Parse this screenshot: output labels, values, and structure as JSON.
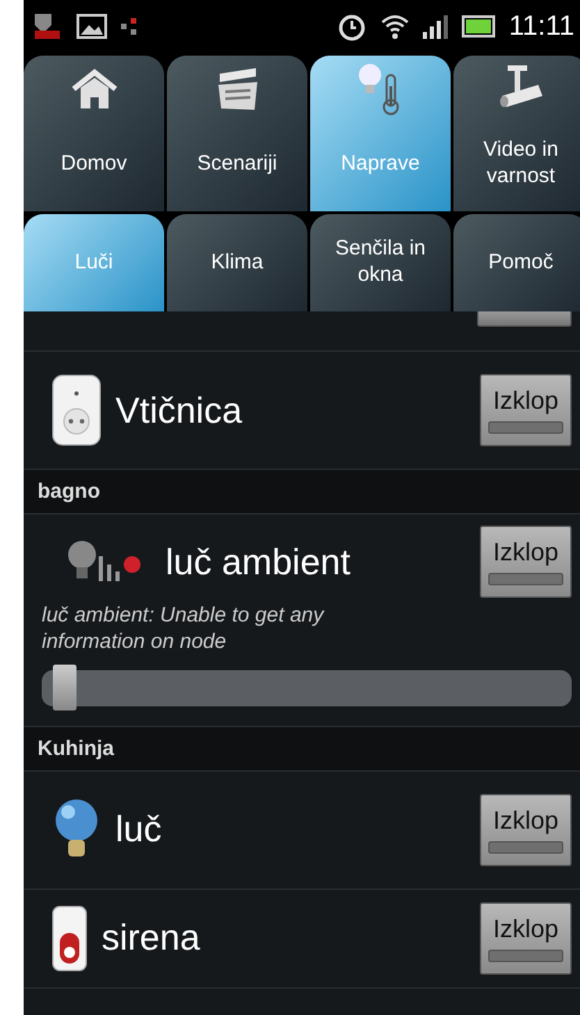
{
  "status_bar": {
    "time": "11:11"
  },
  "main_tabs": [
    {
      "label": "Domov",
      "kind": "home",
      "selected": false
    },
    {
      "label": "Scenariji",
      "kind": "scenes",
      "selected": false
    },
    {
      "label": "Naprave",
      "kind": "devices",
      "selected": true
    },
    {
      "label": "Video in varnost",
      "kind": "video",
      "selected": false
    }
  ],
  "sub_tabs": [
    {
      "label": "Luči",
      "selected": true
    },
    {
      "label": "Klima",
      "selected": false
    },
    {
      "label": "Senčila in okna",
      "selected": false
    },
    {
      "label": "Pomoč",
      "selected": false
    }
  ],
  "list": [
    {
      "kind": "socket",
      "name": "Vtičnica",
      "button": "Izklop",
      "on": false
    },
    {
      "kind": "header",
      "name": "bagno"
    },
    {
      "kind": "dimmer",
      "name": "luč ambient",
      "button": "Izklop",
      "on": false,
      "message": "luč ambient: Unable to get any information on node",
      "level": 0.02
    },
    {
      "kind": "header",
      "name": "Kuhinja"
    },
    {
      "kind": "light",
      "name": "luč",
      "button": "Izklop",
      "on": false
    },
    {
      "kind": "siren",
      "name": "sirena",
      "button": "Izklop",
      "on": false
    }
  ]
}
